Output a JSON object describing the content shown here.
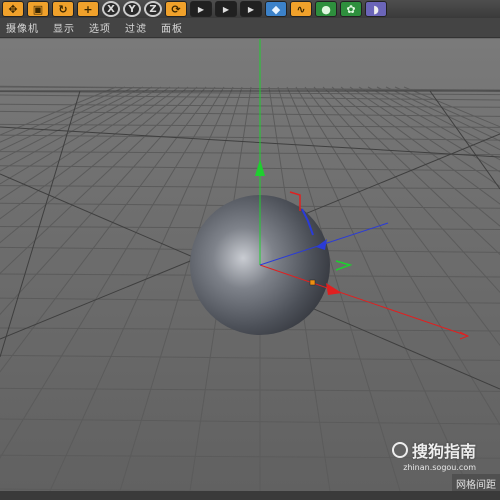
{
  "toolbar": {
    "buttons": [
      {
        "name": "move-tool-button",
        "glyph": "✥",
        "style": "orange"
      },
      {
        "name": "scale-tool-button",
        "glyph": "▣",
        "style": "orange"
      },
      {
        "name": "rotate-tool-button",
        "glyph": "↻",
        "style": "orange"
      },
      {
        "name": "add-tool-button",
        "glyph": "+",
        "style": "orange"
      },
      {
        "name": "x-axis-lock-button",
        "glyph": "X",
        "style": "round"
      },
      {
        "name": "y-axis-lock-button",
        "glyph": "Y",
        "style": "round"
      },
      {
        "name": "z-axis-lock-button",
        "glyph": "Z",
        "style": "round"
      },
      {
        "name": "coordinate-system-button",
        "glyph": "⟳",
        "style": "orange"
      },
      {
        "name": "render-view-button",
        "glyph": "▶",
        "style": "film"
      },
      {
        "name": "render-picture-viewer-button",
        "glyph": "▶",
        "style": "film"
      },
      {
        "name": "edit-render-settings-button",
        "glyph": "▶",
        "style": "film"
      },
      {
        "name": "cube-object-button",
        "glyph": "◆",
        "style": "blue"
      },
      {
        "name": "spline-pen-button",
        "glyph": "∿",
        "style": "orange"
      },
      {
        "name": "subdivision-surface-button",
        "glyph": "●",
        "style": "green"
      },
      {
        "name": "array-button",
        "glyph": "✿",
        "style": "green"
      },
      {
        "name": "deformer-button",
        "glyph": "◗",
        "style": "purple"
      }
    ]
  },
  "menu": {
    "items": [
      "摄像机",
      "显示",
      "选项",
      "过滤",
      "面板"
    ]
  },
  "viewport": {
    "axis_colors": {
      "x": "#e02020",
      "y": "#1fcf2f",
      "z": "#2a3bd8"
    }
  },
  "watermark": {
    "brand": "搜狗指南",
    "url": "zhinan.sogou.com"
  },
  "corner_label": "网格间距"
}
